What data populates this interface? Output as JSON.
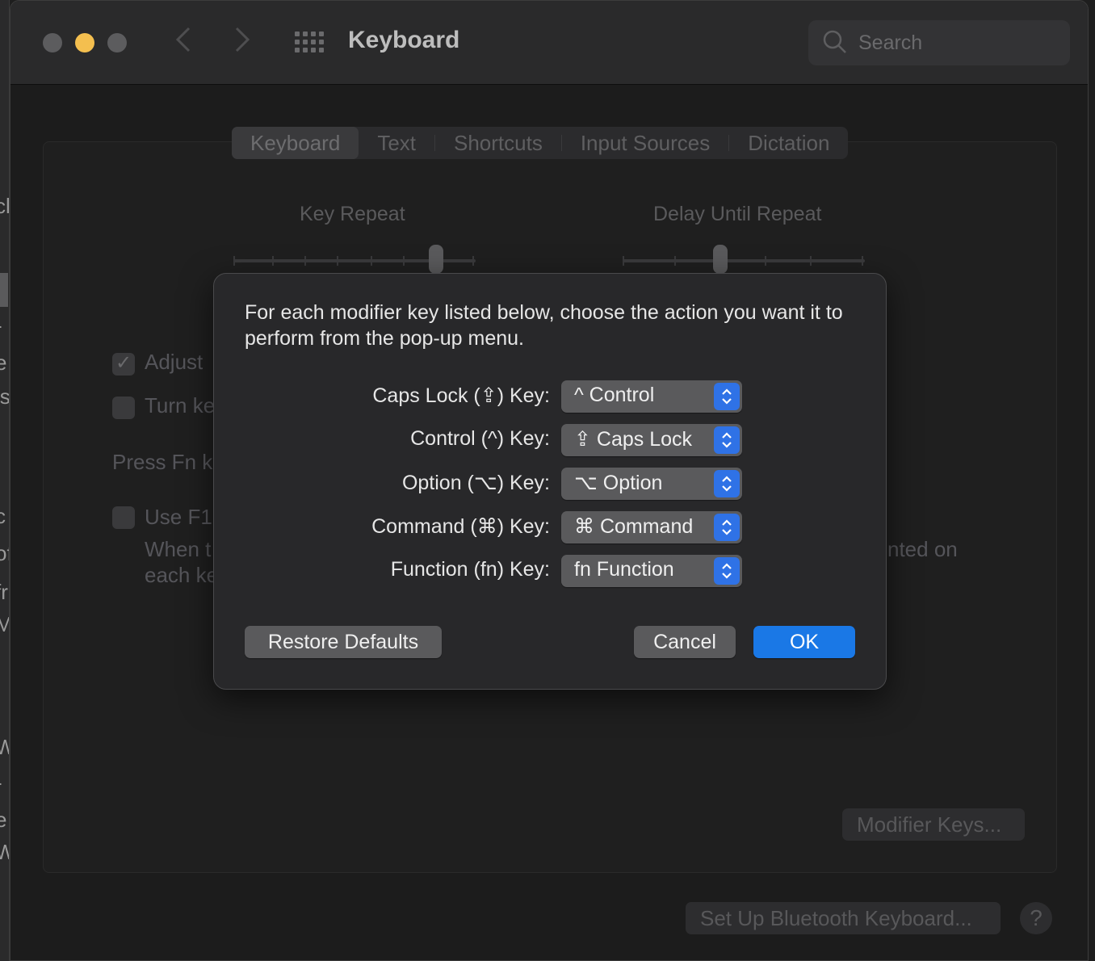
{
  "window": {
    "title": "Keyboard"
  },
  "search": {
    "placeholder": "Search"
  },
  "tabs": [
    {
      "label": "Keyboard",
      "active": true
    },
    {
      "label": "Text",
      "active": false
    },
    {
      "label": "Shortcuts",
      "active": false
    },
    {
      "label": "Input Sources",
      "active": false
    },
    {
      "label": "Dictation",
      "active": false
    }
  ],
  "keyboard_pane": {
    "key_repeat_label": "Key Repeat",
    "delay_label": "Delay Until Repeat",
    "adjust_label_fragment": "Adjust",
    "turn_label_fragment": "Turn ke",
    "press_fn_fragment": "Press Fn k",
    "use_f1_fragment": "Use F1,",
    "when_fragment": "When t",
    "each_fragment": "each ke",
    "printed_on_fragment": "nted on",
    "modifier_keys_button": "Modifier Keys...",
    "bluetooth_button": "Set Up Bluetooth Keyboard...",
    "help_label": "?"
  },
  "sheet": {
    "message": "For each modifier key listed below, choose the action you want it to perform from the pop-up menu.",
    "rows": [
      {
        "label": "Caps Lock (⇪) Key:",
        "value": "^ Control"
      },
      {
        "label": "Control (^) Key:",
        "value": "⇪ Caps Lock"
      },
      {
        "label": "Option (⌥) Key:",
        "value": "⌥ Option"
      },
      {
        "label": "Command (⌘) Key:",
        "value": "⌘ Command"
      },
      {
        "label": "Function (fn) Key:",
        "value": "fn Function"
      }
    ],
    "restore_button": "Restore Defaults",
    "cancel_button": "Cancel",
    "ok_button": "OK"
  },
  "colors": {
    "accent": "#1a78e6",
    "minimize": "#f4bf4f"
  }
}
